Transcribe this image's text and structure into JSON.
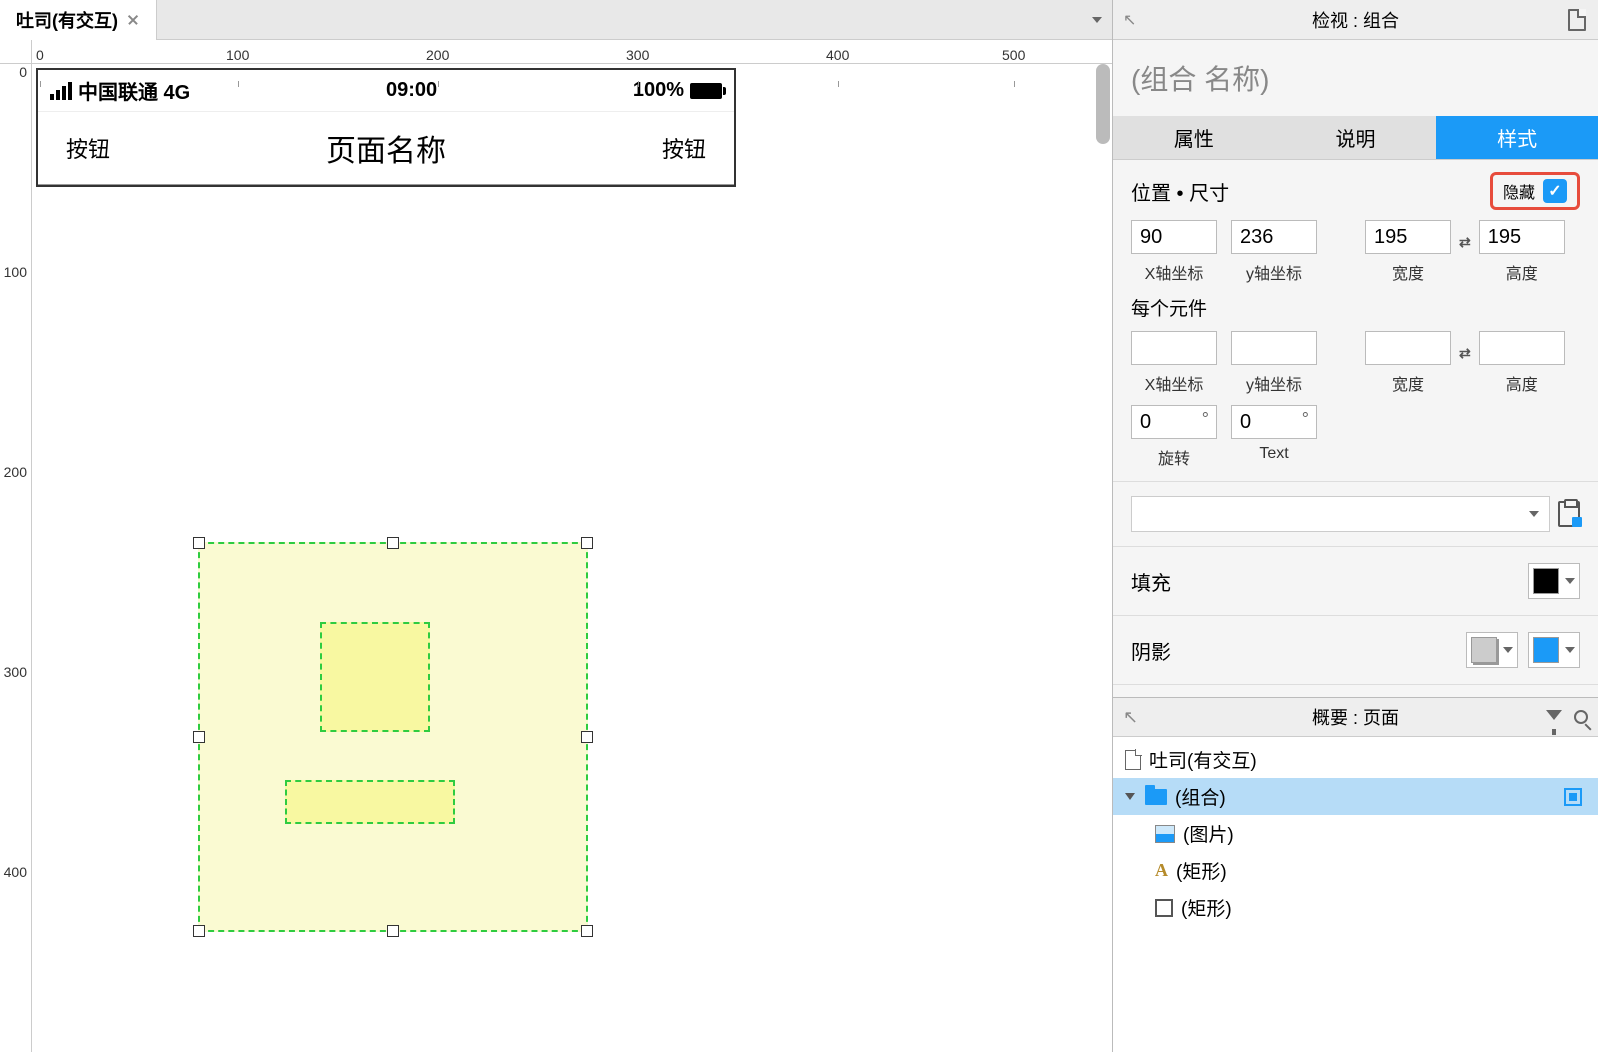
{
  "tab": {
    "title": "吐司(有交互)"
  },
  "ruler": {
    "h": [
      "0",
      "100",
      "200",
      "300",
      "400",
      "500"
    ],
    "v": [
      "0",
      "100",
      "200",
      "300",
      "400"
    ]
  },
  "device": {
    "carrier": "中国联通 4G",
    "time": "09:00",
    "battery": "100%",
    "nav_left": "按钮",
    "nav_title": "页面名称",
    "nav_right": "按钮"
  },
  "inspector": {
    "header": "检视 : 组合",
    "group_name": "(组合 名称)",
    "tabs": {
      "props": "属性",
      "notes": "说明",
      "style": "样式"
    },
    "position_size_label": "位置 • 尺寸",
    "hide_label": "隐藏",
    "fields": {
      "x": "90",
      "y": "236",
      "w": "195",
      "h": "195",
      "x_label": "X轴坐标",
      "y_label": "y轴坐标",
      "w_label": "宽度",
      "h_label": "高度",
      "per_element": "每个元件",
      "rot": "0",
      "rot_label": "旋转",
      "text_rot": "0",
      "text_label": "Text"
    },
    "fill_label": "填充",
    "shadow_label": "阴影"
  },
  "outline": {
    "header": "概要 : 页面",
    "items": {
      "page": "吐司(有交互)",
      "group": "(组合)",
      "image": "(图片)",
      "rect1": "(矩形)",
      "rect2": "(矩形)"
    }
  }
}
